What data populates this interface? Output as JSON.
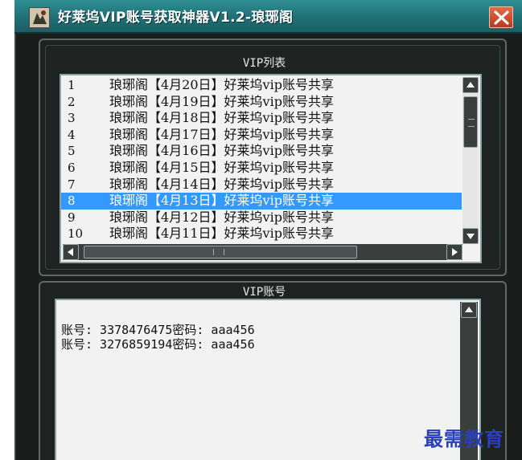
{
  "window": {
    "title": "好莱坞VIP账号获取神器V1.2-琅琊阁",
    "accent": "#2f8f94"
  },
  "vip_list": {
    "label": "VIP列表",
    "items": [
      {
        "num": "1",
        "text": "琅琊阁【4月20日】好莱坞vip账号共享"
      },
      {
        "num": "2",
        "text": "琅琊阁【4月19日】好莱坞vip账号共享"
      },
      {
        "num": "3",
        "text": "琅琊阁【4月18日】好莱坞vip账号共享"
      },
      {
        "num": "4",
        "text": "琅琊阁【4月17日】好莱坞vip账号共享"
      },
      {
        "num": "5",
        "text": "琅琊阁【4月16日】好莱坞vip账号共享"
      },
      {
        "num": "6",
        "text": "琅琊阁【4月15日】好莱坞vip账号共享"
      },
      {
        "num": "7",
        "text": "琅琊阁【4月14日】好莱坞vip账号共享"
      },
      {
        "num": "8",
        "text": "琅琊阁【4月13日】好莱坞vip账号共享",
        "selected": true
      },
      {
        "num": "9",
        "text": "琅琊阁【4月12日】好莱坞vip账号共享"
      },
      {
        "num": "10",
        "text": "琅琊阁【4月11日】好莱坞vip账号共享"
      }
    ],
    "selection_color": "#3399ff"
  },
  "vip_accounts": {
    "label": "VIP账号",
    "lines": [
      "账号: 3378476475密码: aaa456",
      "账号: 3276859194密码: aaa456"
    ]
  },
  "watermark": {
    "text": "最需教育",
    "color": "#2a3fb8"
  }
}
